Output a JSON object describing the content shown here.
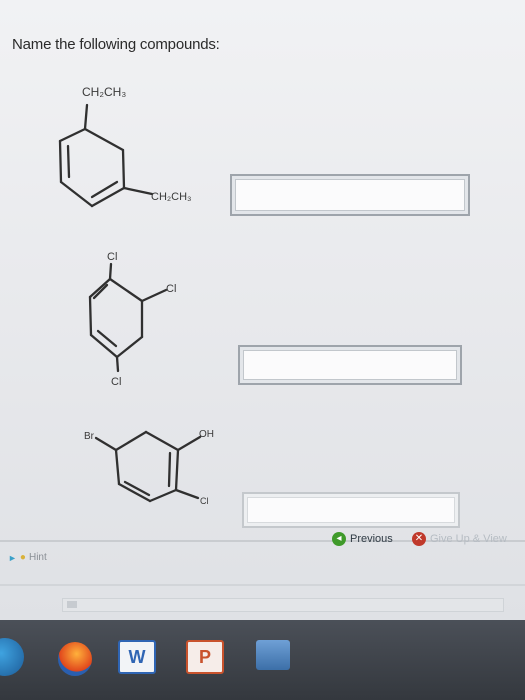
{
  "question": {
    "title": "Name the following compounds:"
  },
  "molecules": [
    {
      "substituent_top": "CH₂CH₃",
      "substituent_right": "CH₂CH₃"
    },
    {
      "substituent_top": "Cl",
      "substituent_right": "Cl",
      "substituent_bottom": "Cl"
    },
    {
      "substituent_left": "Br",
      "substituent_right": "OH",
      "substituent_bottom": "Cl"
    }
  ],
  "navigation": {
    "previous_label": "Previous",
    "giveup_label": "Give Up & View"
  },
  "hint": {
    "label": "Hint"
  },
  "taskbar": {
    "word_label": "W",
    "ppt_label": "P"
  },
  "colors": {
    "accent_green": "#3f9a2a",
    "giveup_red": "#c0392b",
    "taskbar": "#3a3e44"
  }
}
